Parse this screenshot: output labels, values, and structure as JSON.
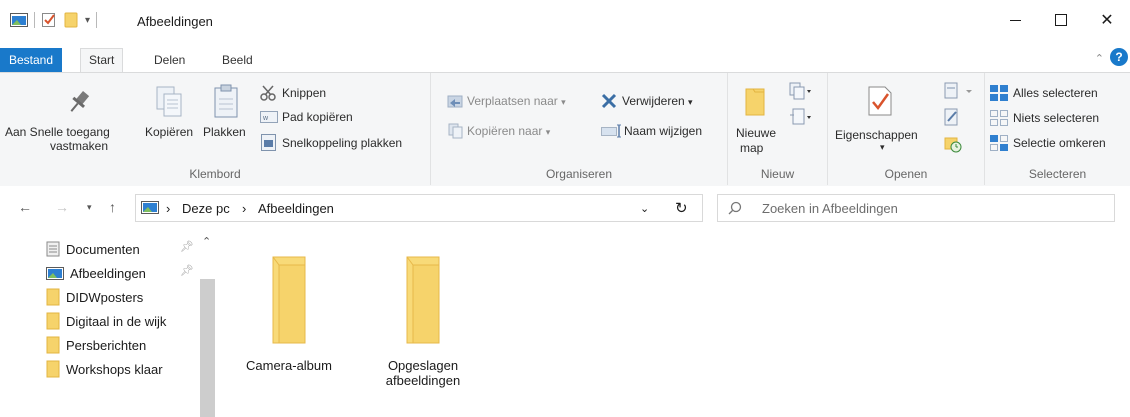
{
  "window": {
    "title": "Afbeeldingen",
    "close_glyph": "✕"
  },
  "tabs": {
    "file": "Bestand",
    "start": "Start",
    "share": "Delen",
    "view": "Beeld"
  },
  "ribbon": {
    "clipboard": {
      "label": "Klembord",
      "pin_quick_access": "Aan Snelle toegang",
      "pin_quick_access_2": "vastmaken",
      "copy": "Kopiëren",
      "paste": "Plakken",
      "cut": "Knippen",
      "copy_path": "Pad kopiëren",
      "paste_shortcut": "Snelkoppeling plakken"
    },
    "organize": {
      "label": "Organiseren",
      "move_to": "Verplaatsen naar",
      "copy_to": "Kopiëren naar",
      "delete": "Verwijderen",
      "rename": "Naam wijzigen"
    },
    "new": {
      "label": "Nieuw",
      "new_folder": "Nieuwe",
      "new_folder_2": "map"
    },
    "open": {
      "label": "Openen",
      "properties": "Eigenschappen"
    },
    "select": {
      "label": "Selecteren",
      "select_all": "Alles selecteren",
      "select_none": "Niets selecteren",
      "invert_selection": "Selectie omkeren"
    }
  },
  "address": {
    "crumbs": [
      "Deze pc",
      "Afbeeldingen"
    ],
    "separator": "›"
  },
  "search": {
    "placeholder": "Zoeken in Afbeeldingen"
  },
  "nav_pane": {
    "items": [
      {
        "label": "Documenten",
        "pinned": true
      },
      {
        "label": "Afbeeldingen",
        "pinned": true
      },
      {
        "label": "DIDWposters",
        "pinned": false
      },
      {
        "label": "Digitaal in de wijk",
        "pinned": false
      },
      {
        "label": "Persberichten",
        "pinned": false
      },
      {
        "label": "Workshops klaar",
        "pinned": false
      }
    ]
  },
  "content": {
    "folders": [
      {
        "line1": "Camera-album",
        "line2": ""
      },
      {
        "line1": "Opgeslagen",
        "line2": "afbeeldingen"
      }
    ]
  },
  "colors": {
    "accent": "#1979ca",
    "folder": "#f6d36b",
    "folder_dark": "#e8b53a"
  }
}
